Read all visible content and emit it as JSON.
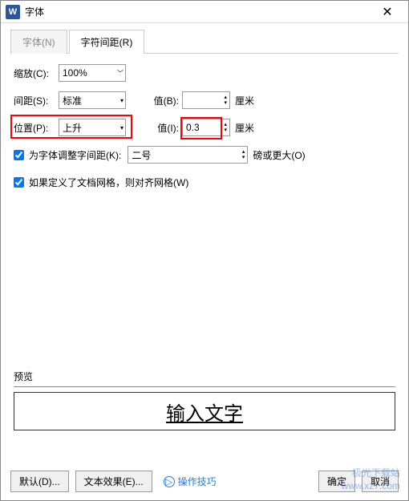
{
  "window": {
    "title": "字体",
    "icon": "W"
  },
  "tabs": {
    "font": "字体(N)",
    "spacing": "字符间距(R)"
  },
  "form": {
    "scale_label": "缩放(C):",
    "scale_value": "100%",
    "spacing_label": "间距(S):",
    "spacing_value": "标准",
    "spacing_val_label": "值(B):",
    "spacing_val": "",
    "spacing_unit": "厘米",
    "position_label": "位置(P):",
    "position_value": "上升",
    "position_val_label": "值(I):",
    "position_val": "0.3",
    "position_unit": "厘米",
    "kerning_label": "为字体调整字间距(K):",
    "kerning_size": "二号",
    "kerning_unit": "磅或更大(O)",
    "grid_label": "如果定义了文档网格，则对齐网格(W)"
  },
  "preview": {
    "header": "预览",
    "text": "输入文字"
  },
  "footer": {
    "default": "默认(D)...",
    "effects": "文本效果(E)...",
    "tips": "操作技巧",
    "ok": "确定",
    "cancel": "取消"
  },
  "watermark": {
    "line1": "极光下载站",
    "line2": "www.xz7.com"
  }
}
